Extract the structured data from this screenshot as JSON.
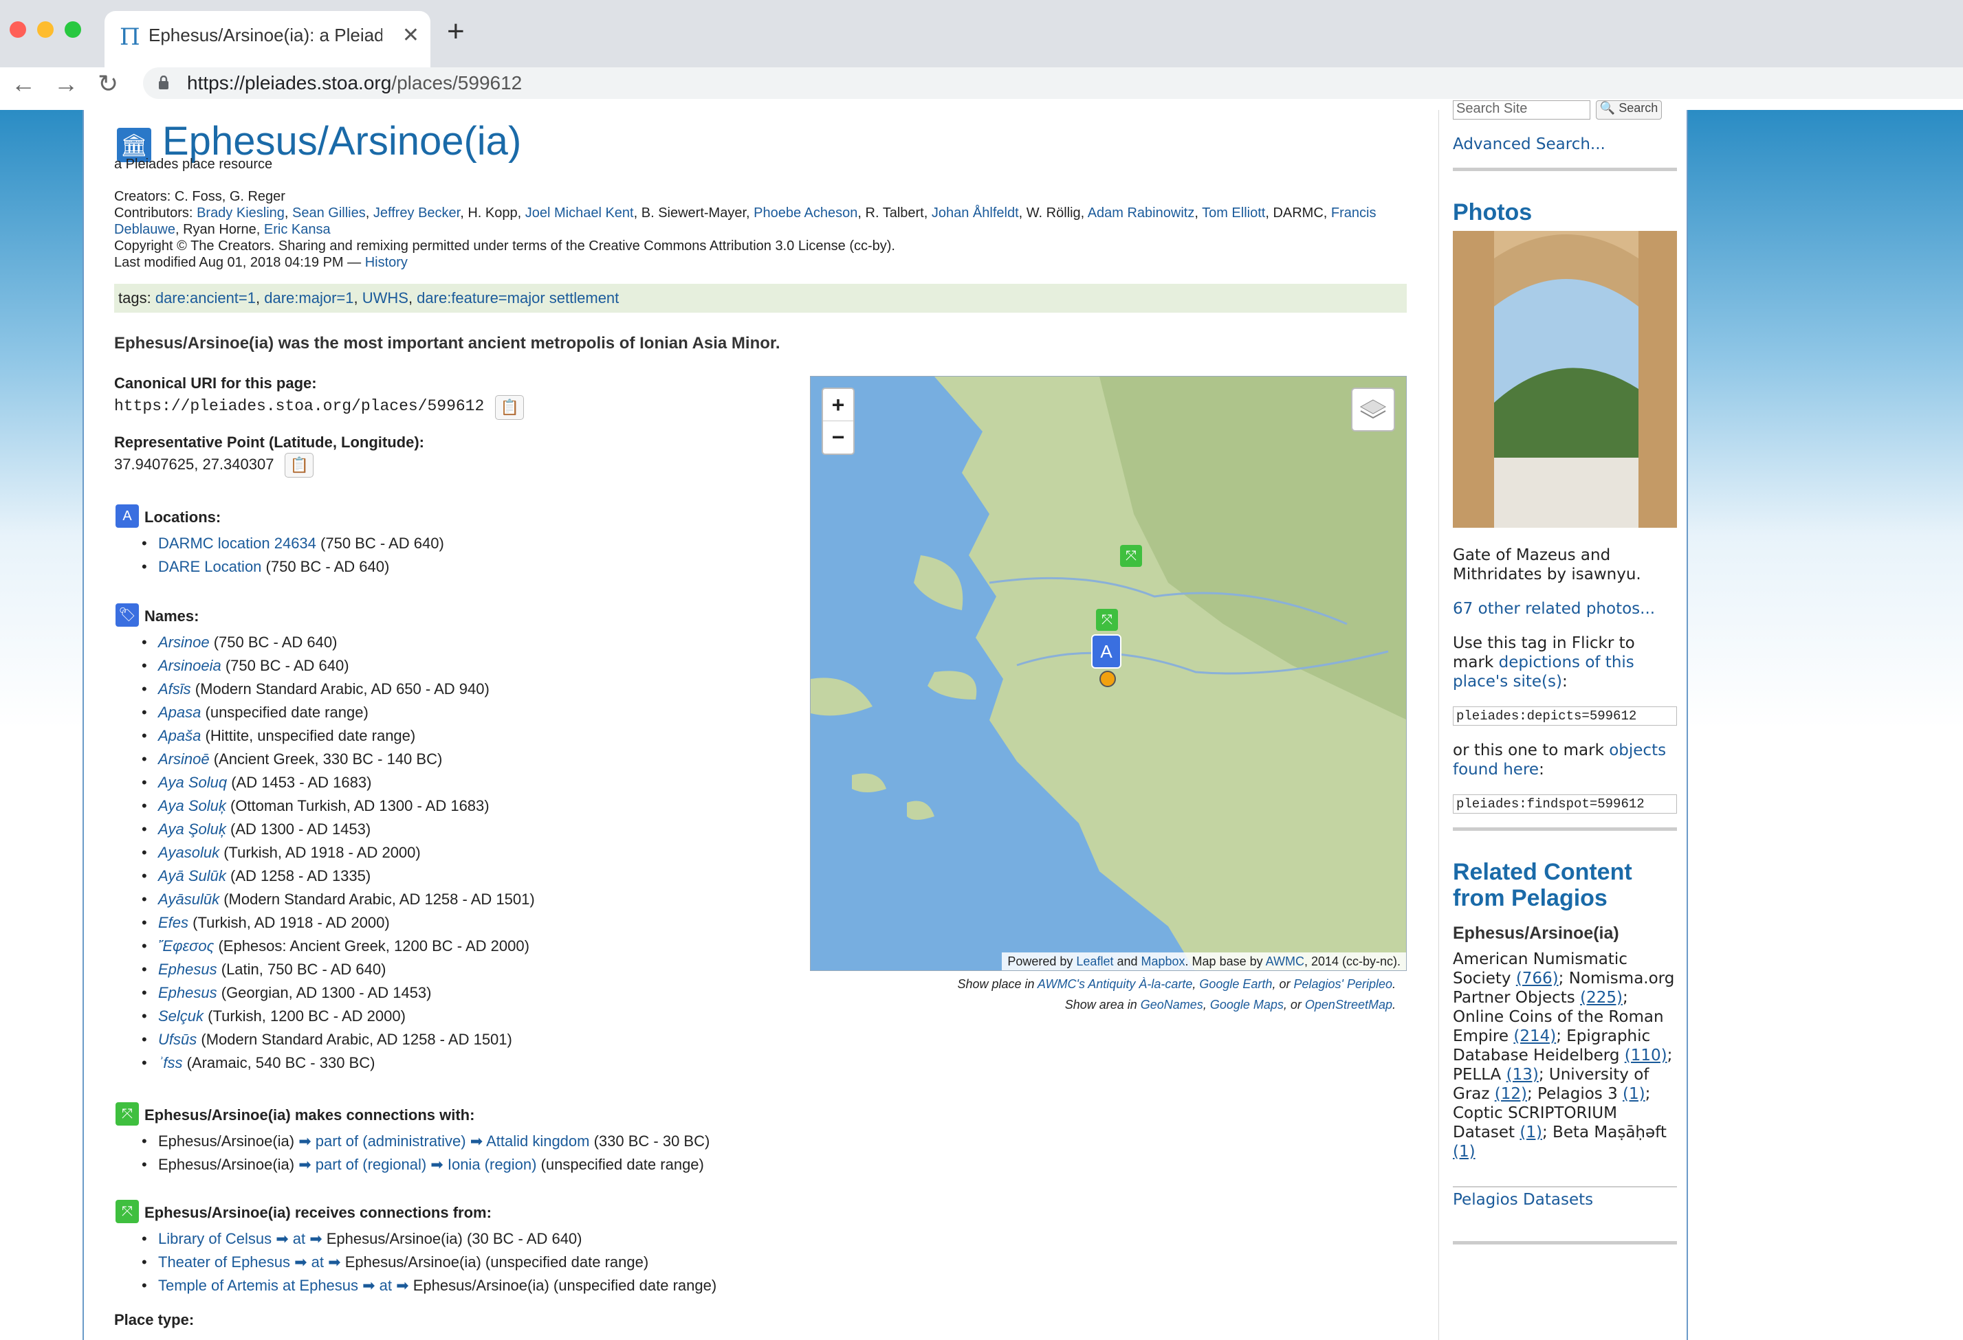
{
  "browser": {
    "tab_title": "Ephesus/Arsinoe(ia): a Pleiade",
    "tab_icon": "Π",
    "url_host": "https://pleiades.stoa.org",
    "url_path": "/places/599612"
  },
  "page": {
    "title": "Ephesus/Arsinoe(ia)",
    "subtitle": "a Pleiades place resource",
    "creators_label": "Creators:",
    "creators": "C. Foss, G. Reger",
    "contributors_label": "Contributors:",
    "contributors": [
      {
        "name": "Brady Kiesling",
        "link": true
      },
      {
        "name": "Sean Gillies",
        "link": true
      },
      {
        "name": "Jeffrey Becker",
        "link": true
      },
      {
        "name": "H. Kopp",
        "link": false
      },
      {
        "name": "Joel Michael Kent",
        "link": true
      },
      {
        "name": "B. Siewert-Mayer",
        "link": false
      },
      {
        "name": "Phoebe Acheson",
        "link": true
      },
      {
        "name": "R. Talbert",
        "link": false
      },
      {
        "name": "Johan Åhlfeldt",
        "link": true
      },
      {
        "name": "W. Röllig",
        "link": false
      },
      {
        "name": "Adam Rabinowitz",
        "link": true
      },
      {
        "name": "Tom Elliott",
        "link": true
      },
      {
        "name": "DARMC",
        "link": false
      },
      {
        "name": "Francis Deblauwe",
        "link": true
      },
      {
        "name": "Ryan Horne",
        "link": false
      },
      {
        "name": "Eric Kansa",
        "link": true
      }
    ],
    "copyright": "Copyright © The Creators. Sharing and remixing permitted under terms of the Creative Commons Attribution 3.0 License (cc-by).",
    "modified": "Last modified Aug 01, 2018 04:19 PM —",
    "history_link": "History",
    "tags_label": "tags:",
    "tags": [
      "dare:ancient=1",
      "dare:major=1",
      "UWHS",
      "dare:feature=major settlement"
    ],
    "description": "Ephesus/Arsinoe(ia) was the most important ancient metropolis of Ionian Asia Minor.",
    "canonical_label": "Canonical URI for this page:",
    "canonical_uri": "https://pleiades.stoa.org/places/599612",
    "rep_point_label": "Representative Point (Latitude, Longitude):",
    "rep_point": "37.9407625, 27.340307",
    "locations_label": "Locations:",
    "locations": [
      {
        "name": "DARMC location 24634",
        "range": " (750 BC - AD 640)"
      },
      {
        "name": "DARE Location",
        "range": " (750 BC - AD 640)"
      }
    ],
    "names_label": "Names:",
    "names": [
      {
        "name": "Arsinoe",
        "info": " (750 BC - AD 640)"
      },
      {
        "name": "Arsinoeia",
        "info": " (750 BC - AD 640)"
      },
      {
        "name": "Afsīs",
        "info": " (Modern Standard Arabic, AD 650 - AD 940)"
      },
      {
        "name": "Apasa",
        "info": " (unspecified date range)"
      },
      {
        "name": "Apaša",
        "info": " (Hittite, unspecified date range)"
      },
      {
        "name": "Arsinoē",
        "info": " (Ancient Greek, 330 BC - 140 BC)"
      },
      {
        "name": "Aya Soluq",
        "info": " (AD 1453 - AD 1683)"
      },
      {
        "name": "Aya Soluķ",
        "info": " (Ottoman Turkish, AD 1300 - AD 1683)"
      },
      {
        "name": "Aya Şoluķ",
        "info": " (AD 1300 - AD 1453)"
      },
      {
        "name": "Ayasoluk",
        "info": " (Turkish, AD 1918 - AD 2000)"
      },
      {
        "name": "Ayā Sulūk",
        "info": " (AD 1258 - AD 1335)"
      },
      {
        "name": "Ayāsulūk",
        "info": " (Modern Standard Arabic, AD 1258 - AD 1501)"
      },
      {
        "name": "Efes",
        "info": " (Turkish, AD 1918 - AD 2000)"
      },
      {
        "name": "Ἔφεσος",
        "info": " (Ephesos: Ancient Greek, 1200 BC - AD 2000)"
      },
      {
        "name": "Ephesus",
        "info": " (Latin, 750 BC - AD 640)"
      },
      {
        "name": "Ephesus",
        "info": " (Georgian, AD 1300 - AD 1453)"
      },
      {
        "name": "Selçuk",
        "info": " (Turkish, 1200 BC - AD 2000)"
      },
      {
        "name": "Ufsūs",
        "info": " (Modern Standard Arabic, AD 1258 - AD 1501)"
      },
      {
        "name": "ʾfss",
        "info": " (Aramaic, 540 BC - 330 BC)"
      }
    ],
    "connections_label": "Ephesus/Arsinoe(ia) makes connections with:",
    "connections": [
      {
        "from": "Ephesus/Arsinoe(ia) ",
        "rel": "➡ part of (administrative) ➡",
        "to": " Attalid kingdom",
        "range": " (330 BC - 30 BC)"
      },
      {
        "from": "Ephesus/Arsinoe(ia) ",
        "rel": "➡ part of (regional) ➡",
        "to": " Ionia (region)",
        "range": " (unspecified date range)"
      }
    ],
    "receives_label": "Ephesus/Arsinoe(ia) receives connections from:",
    "receives": [
      {
        "from": "Library of Celsus ",
        "rel": "➡ at ➡",
        "to": " Ephesus/Arsinoe(ia)",
        "range": " (30 BC - AD 640)"
      },
      {
        "from": "Theater of Ephesus ",
        "rel": "➡ at ➡",
        "to": " Ephesus/Arsinoe(ia)",
        "range": " (unspecified date range)"
      },
      {
        "from": "Temple of Artemis at Ephesus ",
        "rel": "➡ at ➡",
        "to": " Ephesus/Arsinoe(ia)",
        "range": " (unspecified date range)"
      }
    ],
    "place_type_label": "Place type:",
    "map": {
      "zoom_in": "+",
      "zoom_out": "−",
      "attrib_powered": "Powered by ",
      "attrib_leaflet": "Leaflet",
      "attrib_and": " and ",
      "attrib_mapbox": "Mapbox",
      "attrib_base": ". Map base by ",
      "attrib_awmc": "AWMC",
      "attrib_year": ", 2014 (cc-by-nc).",
      "caption1_pre": "Show place in ",
      "caption1_links": [
        "AWMC's Antiquity À-la-carte",
        "Google Earth"
      ],
      "caption1_or": ", or ",
      "caption1_last": "Pelagios' Peripleo",
      "caption2_pre": "Show area in ",
      "caption2_links": [
        "GeoNames",
        "Google Maps"
      ],
      "caption2_last": "OpenStreetMap"
    }
  },
  "sidebar": {
    "search_placeholder": "Search Site",
    "search_button": "Search",
    "advanced_search": "Advanced Search...",
    "photos_title": "Photos",
    "photo_caption": "Gate of Mazeus and Mithridates by isawnyu.",
    "other_photos": "67 other related photos...",
    "flickr_text1": "Use this tag in Flickr to mark ",
    "flickr_link1": "depictions of this place's site(s)",
    "flickr_tag1": "pleiades:depicts=599612",
    "flickr_text2": "or this one to mark ",
    "flickr_link2": "objects found here",
    "flickr_tag2": "pleiades:findspot=599612",
    "related_title": "Related Content from Pelagios",
    "related_place": "Ephesus/Arsinoe(ia)",
    "related": [
      {
        "name": "American Numismatic Society",
        "count": "(766)",
        "sep": ";"
      },
      {
        "name": "Nomisma.org Partner Objects",
        "count": "(225)",
        "sep": ";"
      },
      {
        "name": "Online Coins of the Roman Empire",
        "count": "(214)",
        "sep": ";"
      },
      {
        "name": "Epigraphic Database Heidelberg",
        "count": "(110)",
        "sep": ";"
      },
      {
        "name": "PELLA",
        "count": "(13)",
        "sep": ";"
      },
      {
        "name": "University of Graz",
        "count": "(12)",
        "sep": ";"
      },
      {
        "name": "Pelagios 3",
        "count": "(1)",
        "sep": ";"
      },
      {
        "name": "Coptic SCRIPTORIUM Dataset",
        "count": "(1)",
        "sep": ";"
      },
      {
        "name": "Beta Maṣāḥǝft",
        "count": "(1)",
        "sep": ""
      }
    ],
    "datasets_link": "Pelagios Datasets"
  },
  "colors": {
    "link": "#1a5a9a",
    "heading": "#1a6aa8",
    "tag_bg": "#e6efdd",
    "map_sea": "#77aee0",
    "map_land": "#b9cf9c",
    "marker_green": "#3fbf3f",
    "marker_blue": "#3a6fe0"
  },
  "icons": {
    "place": "building-icon",
    "locations": "compass-icon",
    "names": "tag-icon",
    "connections": "connection-icon"
  }
}
